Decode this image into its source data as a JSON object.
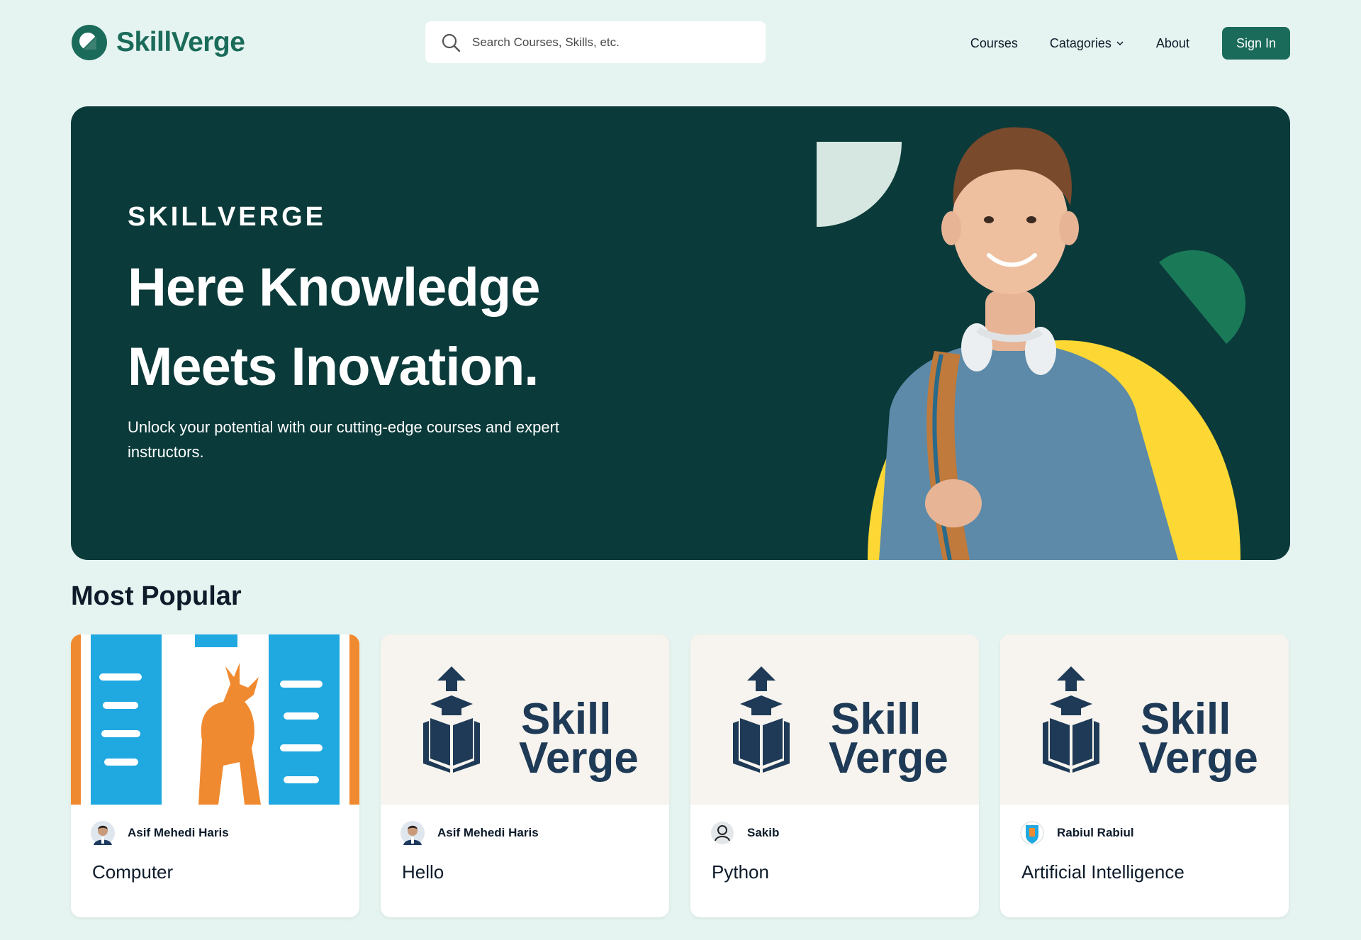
{
  "brand": {
    "name": "SkillVerge"
  },
  "search": {
    "placeholder": "Search Courses, Skills, etc."
  },
  "nav": {
    "courses": "Courses",
    "categories": "Catagories",
    "about": "About",
    "signin": "Sign In"
  },
  "hero": {
    "eyebrow": "SKILLVERGE",
    "title": "Here Knowledge Meets Inovation.",
    "subtitle": "Unlock your potential with our cutting-edge courses and expert instructors."
  },
  "popular": {
    "title": "Most Popular",
    "cards": [
      {
        "author": "Asif Mehedi Haris",
        "title": "Computer",
        "thumbnail": "university-crest-deer",
        "avatar": "photo-avatar"
      },
      {
        "author": "Asif Mehedi Haris",
        "title": "Hello",
        "thumbnail": "skill-verge-logo",
        "avatar": "photo-avatar",
        "thumb_text_1": "Skill",
        "thumb_text_2": "Verge"
      },
      {
        "author": "Sakib",
        "title": "Python",
        "thumbnail": "skill-verge-logo",
        "avatar": "default-user-icon",
        "thumb_text_1": "Skill",
        "thumb_text_2": "Verge"
      },
      {
        "author": "Rabiul Rabiul",
        "title": "Artificial Intelligence",
        "thumbnail": "skill-verge-logo",
        "avatar": "crest-avatar",
        "thumb_text_1": "Skill",
        "thumb_text_2": "Verge"
      }
    ]
  },
  "colors": {
    "page_bg": "#e6f4f1",
    "brand_green": "#1a6b5a",
    "hero_bg": "#0b3a3a",
    "accent_yellow": "#fdd835",
    "shape_light": "#d6e6e0",
    "shape_green": "#1a7a58",
    "thumb_navy": "#1e3a56"
  }
}
